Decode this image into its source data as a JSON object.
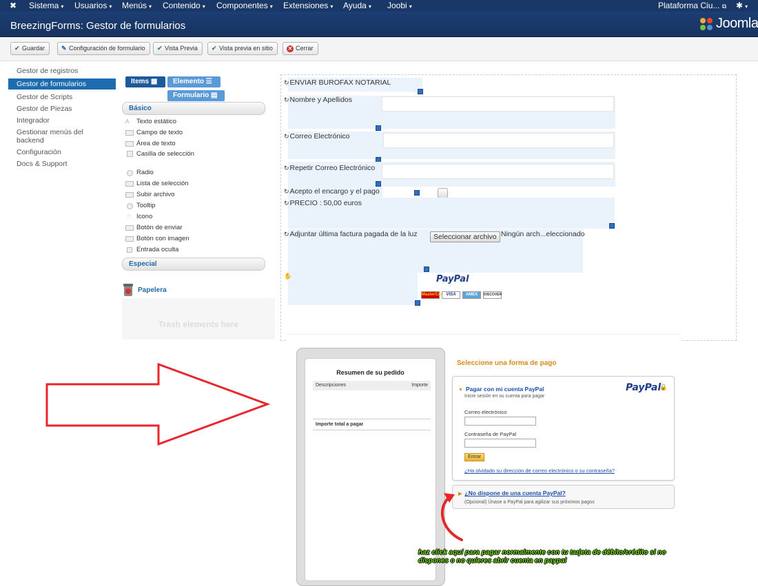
{
  "topnav": {
    "menus": [
      "Sistema",
      "Usuarios",
      "Menús",
      "Contenido",
      "Componentes",
      "Extensiones",
      "Ayuda",
      "Joobi"
    ],
    "site_name": "Plataforma Ciu..."
  },
  "header": {
    "title": "BreezingForms: Gestor de formularios",
    "brand": "Joomla!"
  },
  "toolbar": {
    "save": "Guardar",
    "form_config": "Configuración de formulario",
    "preview": "Vista Previa",
    "preview_site": "Vista previa en sitio",
    "close": "Cerrar"
  },
  "sidebar": {
    "items": [
      {
        "label": "Gestor de registros"
      },
      {
        "label": "Gestor de formularios",
        "active": true
      },
      {
        "label": "Gestor de Scripts"
      },
      {
        "label": "Gestor de Piezas"
      },
      {
        "label": "Integrador"
      },
      {
        "label": "Gestionar menús del backend"
      },
      {
        "label": "Configuración"
      },
      {
        "label": "Docs & Support"
      }
    ]
  },
  "palette": {
    "tabs": {
      "items": "Items",
      "element": "Elemento",
      "form": "Formulario"
    },
    "basic_header": "Básico",
    "special_header": "Especial",
    "basic_items": [
      "Texto estático",
      "Campo de texto",
      "Área de texto",
      "Casilla de selección",
      "Radio",
      "Lista de selección",
      "Subir archivo",
      "Tooltip",
      "Icono",
      "Botón de enviar",
      "Botón con imagen",
      "Entrada oculta"
    ],
    "trash_label": "Papelera",
    "trash_hint": "Trash elements here"
  },
  "form": {
    "title": "ENVIAR BUROFAX NOTARIAL",
    "name_label": "Nombre y Apellidos",
    "email_label": "Correo Electrónico",
    "email_repeat_label": "Repetir Correo Electrónico",
    "accept_label": "Acepto el encargo y el pago",
    "price_label": "PRECIO : 50,00 euros",
    "attach_label": "Adjuntar última factura pagada de la luz",
    "file_button": "Seleccionar archivo",
    "file_status": "Ningún arch...eleccionado",
    "paypal_logo": "PayPal",
    "cards": [
      "MasterCard",
      "VISA",
      "AMEX",
      "DISCOVER"
    ]
  },
  "paypal_page": {
    "summary_title": "Resumen de su pedido",
    "col_desc": "Descripciones",
    "col_amount": "Importe",
    "total_label": "Importe total a pagar",
    "choose_title": "Seleccione una forma de pago",
    "pay_with_account": "Pagar con mi cuenta PayPal",
    "login_hint": "Inicie sesión en su cuenta para pagar",
    "email_label": "Correo electrónico",
    "password_label": "Contraseña de PayPal",
    "login_button": "Entrar",
    "forgot_link": "¿Ha olvidado su dirección de correo electrónico o su contraseña?",
    "no_account_link": "¿No dispone de una cuenta PayPal?",
    "no_account_hint": "(Opcional) Únase a PayPal para agilizar sus próximos pagos",
    "logo": "PayPal"
  },
  "annotation": "haz click aquí para pagar normalmente con tu tarjeta de débito/crédito si no dispones o no quieres abrir cuenta en paypal",
  "colors": {
    "nav": "#1a3867",
    "active": "#1d6cb0",
    "arrow": "#e8262a",
    "note": "#7be21b"
  }
}
